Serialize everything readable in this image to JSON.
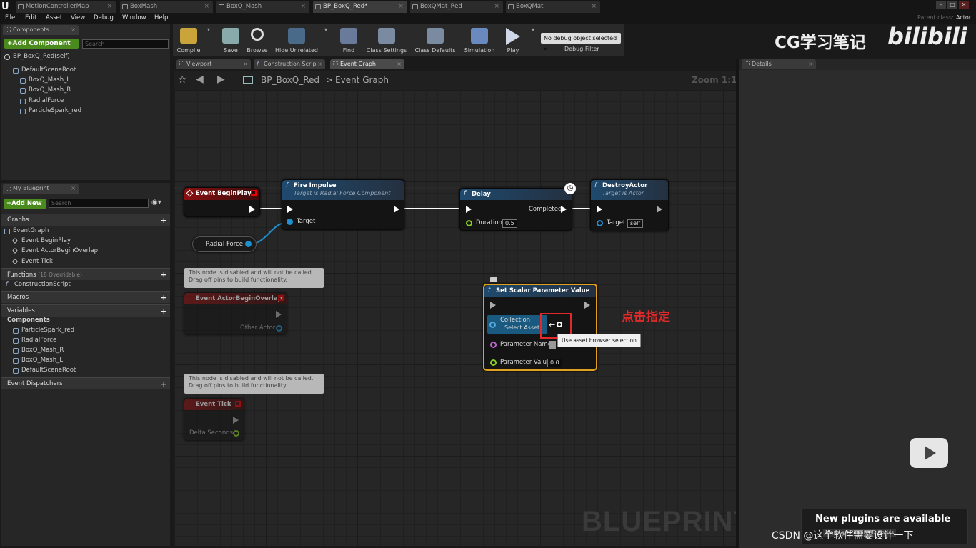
{
  "app": {
    "logo": "U"
  },
  "doc_tabs": [
    {
      "label": "MotionControllerMap"
    },
    {
      "label": "BoxMash"
    },
    {
      "label": "BoxQ_Mash"
    },
    {
      "label": "BP_BoxQ_Red*"
    },
    {
      "label": "BoxQMat_Red"
    },
    {
      "label": "BoxQMat"
    }
  ],
  "window": {
    "parent_class_label": "Parent class:",
    "parent_class_value": "Actor"
  },
  "menu": [
    "File",
    "Edit",
    "Asset",
    "View",
    "Debug",
    "Window",
    "Help"
  ],
  "components": {
    "tab": "Components",
    "add_button": "+Add Component",
    "search_placeholder": "Search",
    "self_label": "BP_BoxQ_Red(self)",
    "tree": [
      "DefaultSceneRoot",
      "BoxQ_Mash_L",
      "BoxQ_Mash_R",
      "RadialForce",
      "ParticleSpark_red"
    ]
  },
  "my_blueprint": {
    "tab": "My Blueprint",
    "add_button": "+Add New",
    "search_placeholder": "Search",
    "graphs_header": "Graphs",
    "event_graph": "EventGraph",
    "events": [
      "Event BeginPlay",
      "Event ActorBeginOverlap",
      "Event Tick"
    ],
    "functions_header": "Functions",
    "functions_note": "(18 Overridable)",
    "functions": [
      "ConstructionScript"
    ],
    "macros_header": "Macros",
    "variables_header": "Variables",
    "components_sub": "Components",
    "variables": [
      "ParticleSpark_red",
      "RadialForce",
      "BoxQ_Mash_R",
      "BoxQ_Mash_L",
      "DefaultSceneRoot"
    ],
    "dispatchers_header": "Event Dispatchers"
  },
  "toolbar": {
    "compile": "Compile",
    "save": "Save",
    "browse": "Browse",
    "hide_unrelated": "Hide Unrelated",
    "find": "Find",
    "class_settings": "Class Settings",
    "class_defaults": "Class Defaults",
    "simulation": "Simulation",
    "play": "Play",
    "debug_select": "No debug object selected",
    "debug_filter": "Debug Filter"
  },
  "editor_tabs": [
    {
      "label": "Viewport"
    },
    {
      "label": "Construction Scrip"
    },
    {
      "label": "Event Graph"
    }
  ],
  "breadcrumb": {
    "blueprint": "BP_BoxQ_Red",
    "separator": ">",
    "graph": "Event Graph",
    "zoom": "Zoom 1:1"
  },
  "details": {
    "tab": "Details"
  },
  "watermark": {
    "title": "CG学习笔记",
    "brand": "bilibili",
    "csdn": "CSDN @这个软件需要设计一下"
  },
  "graph": {
    "watermark": "BLUEPRINT",
    "annotation": "点击指定",
    "begin_play": {
      "title": "Event BeginPlay"
    },
    "fire_impulse": {
      "title": "Fire Impulse",
      "subtitle": "Target is Radial Force Component",
      "target": "Target"
    },
    "radial_force": {
      "label": "Radial Force"
    },
    "delay": {
      "title": "Delay",
      "completed": "Completed",
      "duration": "Duration",
      "duration_value": "0.5"
    },
    "destroy": {
      "title": "DestroyActor",
      "subtitle": "Target is Actor",
      "target": "Target",
      "target_value": "self"
    },
    "disabled_comment": "This node is disabled and will not be called.\nDrag off pins to build functionality.",
    "overlap": {
      "title": "Event ActorBeginOverlap",
      "pin": "Other Actor"
    },
    "tick": {
      "title": "Event Tick",
      "pin": "Delta Seconds"
    },
    "set_scalar": {
      "title": "Set Scalar Parameter Value",
      "collection": "Collection",
      "select_asset": "Select Asset",
      "param_name": "Parameter Name",
      "param_value": "Parameter Value",
      "param_value_val": "0.0",
      "tooltip": "Use asset browser selection"
    }
  },
  "notification": {
    "title": "New plugins are available",
    "sub": "Manage Plugins    Dismiss"
  },
  "colors": {
    "event": "#8a1010",
    "function": "#1f4a6e",
    "exec_wire": "#ffffff",
    "object_wire": "#1f8fd0",
    "highlight": "#e0a020",
    "annotation": "#e02a2a"
  }
}
